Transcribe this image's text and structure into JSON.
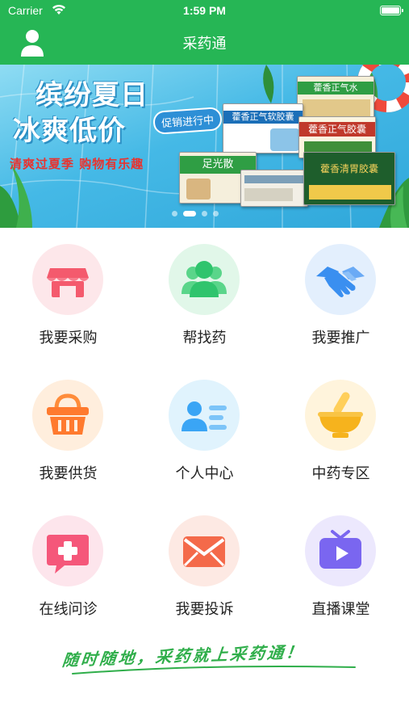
{
  "status_bar": {
    "carrier": "Carrier",
    "time": "1:59 PM"
  },
  "nav": {
    "title": "采药通"
  },
  "banner": {
    "headline_1": "缤纷夏日",
    "headline_2": "冰爽低价",
    "promo_tag": "促销进行中",
    "slogan": "清爽过夏季 购物有乐趣",
    "products": [
      "藿香正气水",
      "藿香正气软胶囊",
      "藿香正气胶囊",
      "足光散",
      "藿香清胃胶囊"
    ],
    "active_slide": 1,
    "slide_count": 4
  },
  "menu": [
    {
      "label": "我要采购",
      "icon": "store-icon",
      "color": "#f45a6d",
      "bg": "#fde7ea"
    },
    {
      "label": "帮找药",
      "icon": "people-icon",
      "color": "#2fc46d",
      "bg": "#e1f7e9"
    },
    {
      "label": "我要推广",
      "icon": "handshake-icon",
      "color": "#3a8ff0",
      "bg": "#e3effd"
    },
    {
      "label": "我要供货",
      "icon": "basket-icon",
      "color": "#ff7a2e",
      "bg": "#ffeedd"
    },
    {
      "label": "个人中心",
      "icon": "profile-card-icon",
      "color": "#3aa5f5",
      "bg": "#e0f3fd"
    },
    {
      "label": "中药专区",
      "icon": "mortar-icon",
      "color": "#f6b31d",
      "bg": "#fff4dc"
    },
    {
      "label": "在线问诊",
      "icon": "medical-chat-icon",
      "color": "#f5577a",
      "bg": "#fde5ec"
    },
    {
      "label": "我要投诉",
      "icon": "mail-icon",
      "color": "#f46a4a",
      "bg": "#fde9e3"
    },
    {
      "label": "直播课堂",
      "icon": "tv-play-icon",
      "color": "#7a66f0",
      "bg": "#ece8fd"
    }
  ],
  "footer": {
    "slogan": "随时随地，采药就上采药通！"
  }
}
